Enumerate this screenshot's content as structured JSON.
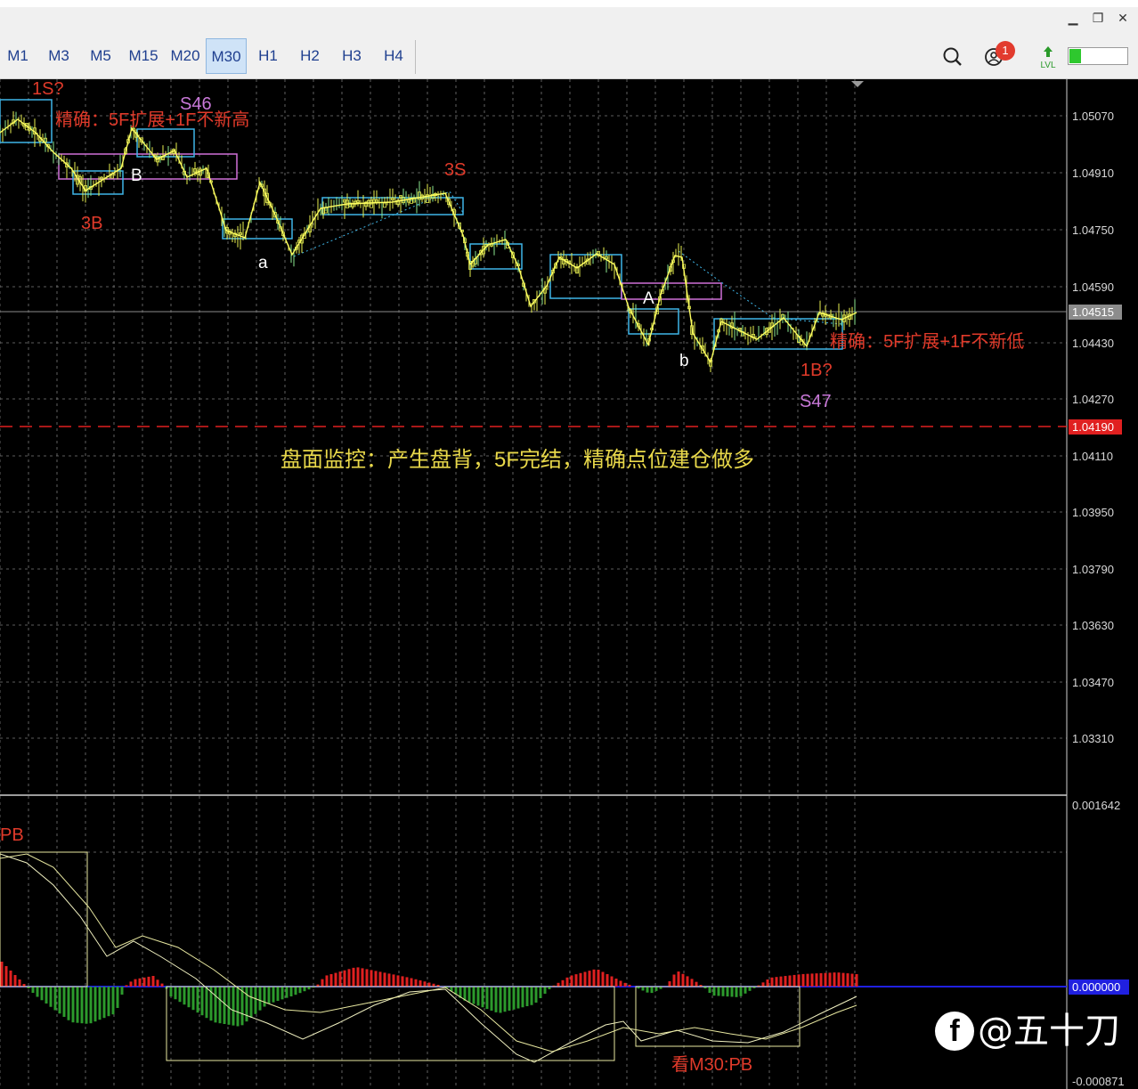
{
  "window": {
    "minimize_glyph": "▁",
    "restore_glyph": "❐",
    "close_glyph": "✕"
  },
  "toolbar": {
    "timeframes": [
      "M1",
      "M3",
      "M5",
      "M15",
      "M20",
      "M30",
      "H1",
      "H2",
      "H3",
      "H4"
    ],
    "active_timeframe": "M30",
    "search_icon": "search-icon",
    "account_icon": "user-notification-icon",
    "notification_count": "1",
    "level_icon": "lvl-icon",
    "level_label": "LVL",
    "signal_strength_fraction": 0.2
  },
  "price_axis": {
    "ticks": [
      "1.05070",
      "1.04910",
      "1.04750",
      "1.04590",
      "1.04430",
      "1.04270",
      "1.04110",
      "1.03950",
      "1.03790",
      "1.03630",
      "1.03470",
      "1.03310"
    ],
    "current_price": "1.04515",
    "alert_price": "1.04190"
  },
  "indicator_axis": {
    "top_label": "0.001642",
    "zero_label": "0.000000",
    "bottom_label": "-0.000871"
  },
  "annotations": {
    "top_1s": "1S?",
    "precise_high": "精确：5F扩展+1F不新高",
    "s46": "S46",
    "label_b_upper": "B",
    "label_3b": "3B",
    "label_3s": "3S",
    "label_a_lower": "a",
    "label_a_upper": "A",
    "label_b_lower": "b",
    "precise_low": "精确：5F扩展+1F不新低",
    "label_1b": "1B?",
    "s47": "S47",
    "monitor": "盘面监控：产生盘背，5F完结，精确点位建仓做多",
    "pb": "PB",
    "m30_pb": "看M30:PB"
  },
  "watermark": {
    "logo": "f",
    "handle": "@五十刀"
  },
  "colors": {
    "annotation_red": "#e03a2a",
    "annotation_purple": "#c878d8",
    "candle_yellow": "#e8f050",
    "box_cyan": "#3fb6e8",
    "box_magenta": "#d070d8",
    "macd_red": "#e02020",
    "macd_green": "#2c9a2c",
    "zero_line_blue": "#2020e0"
  }
}
